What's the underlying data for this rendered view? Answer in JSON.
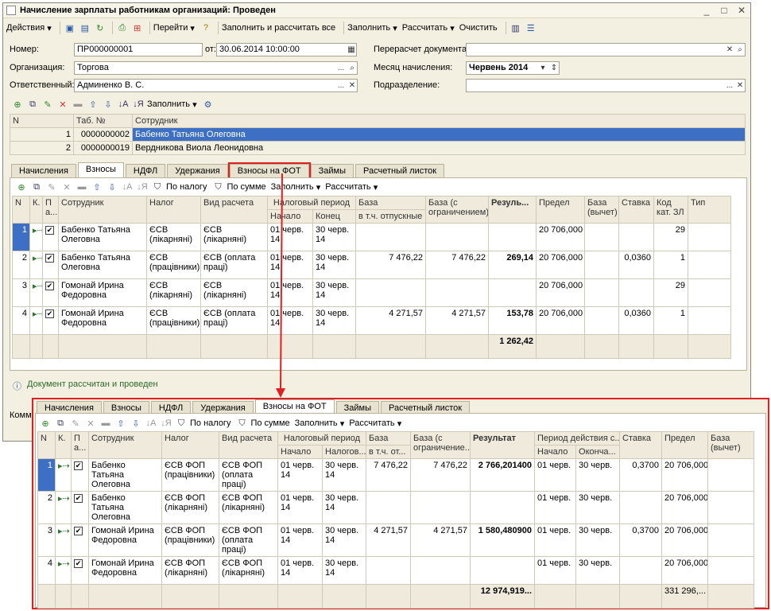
{
  "window": {
    "title": "Начисление зарплаты работникам организаций: Проведен"
  },
  "toolbar": {
    "actions": "Действия",
    "goto": "Перейти",
    "fill_calc_all": "Заполнить и рассчитать все",
    "fill": "Заполнить",
    "calc": "Рассчитать",
    "clear": "Очистить"
  },
  "form": {
    "number_label": "Номер:",
    "number_value": "ПР000000001",
    "from_label": "от:",
    "date_value": "30.06.2014 10:00:00",
    "recalc_label": "Перерасчет документа:",
    "org_label": "Организация:",
    "org_value": "Торгова",
    "month_label": "Месяц начисления:",
    "month_value": "Червень 2014",
    "resp_label": "Ответственный:",
    "resp_value": "Админенко В. С.",
    "dept_label": "Подразделение:"
  },
  "emp_toolbar": {
    "fill": "Заполнить"
  },
  "employees": {
    "headers": [
      "N",
      "Таб. №",
      "Сотрудник"
    ],
    "rows": [
      {
        "n": "1",
        "tab": "0000000002",
        "name": "Бабенко Татьяна Олеговна"
      },
      {
        "n": "2",
        "tab": "0000000019",
        "name": "Вердникова Виола Леонидовна"
      }
    ]
  },
  "tabs": [
    "Начисления",
    "Взносы",
    "НДФЛ",
    "Удержания",
    "Взносы на ФОТ",
    "Займы",
    "Расчетный листок"
  ],
  "grid_toolbar": {
    "by_tax": "По налогу",
    "by_sum": "По сумме",
    "fill": "Заполнить",
    "calc": "Рассчитать"
  },
  "grid1": {
    "headers": {
      "n": "N",
      "k": "К.",
      "p": "П а...",
      "emp": "Сотрудник",
      "tax": "Налог",
      "kind": "Вид расчета",
      "period": "Налоговый период",
      "start": "Начало",
      "end": "Конец",
      "base": "База",
      "base_vac": "в т.ч. отпускные",
      "base_lim": "База (с ограничением)",
      "result": "Резуль...",
      "limit": "Предел",
      "base_ded": "База (вычет)",
      "rate": "Ставка",
      "code": "Код кат. ЗЛ",
      "type": "Тип"
    },
    "rows": [
      {
        "n": "1",
        "emp": "Бабенко Татьяна Олеговна",
        "tax": "ЄСВ (лікарняні)",
        "kind": "ЄСВ (лікарняні)",
        "start": "01 черв. 14",
        "end": "30 черв. 14",
        "base": "",
        "base_lim": "",
        "result": "",
        "limit": "20 706,000",
        "rate": "",
        "code": "29"
      },
      {
        "n": "2",
        "emp": "Бабенко Татьяна Олеговна",
        "tax": "ЄСВ (працівники)",
        "kind": "ЄСВ (оплата праці)",
        "start": "01 черв. 14",
        "end": "30 черв. 14",
        "base": "7 476,22",
        "base_lim": "7 476,22",
        "result": "269,14",
        "limit": "20 706,000",
        "rate": "0,0360",
        "code": "1"
      },
      {
        "n": "3",
        "emp": "Гомонай Ирина Федоровна",
        "tax": "ЄСВ (лікарняні)",
        "kind": "ЄСВ (лікарняні)",
        "start": "01 черв. 14",
        "end": "30 черв. 14",
        "base": "",
        "base_lim": "",
        "result": "",
        "limit": "20 706,000",
        "rate": "",
        "code": "29"
      },
      {
        "n": "4",
        "emp": "Гомонай Ирина Федоровна",
        "tax": "ЄСВ (працівники)",
        "kind": "ЄСВ (оплата праці)",
        "start": "01 черв. 14",
        "end": "30 черв. 14",
        "base": "4 271,57",
        "base_lim": "4 271,57",
        "result": "153,78",
        "limit": "20 706,000",
        "rate": "0,0360",
        "code": "1"
      }
    ],
    "total": "1 262,42"
  },
  "status": {
    "text": "Документ рассчитан и проведен",
    "comment_label": "Комм"
  },
  "grid2": {
    "headers": {
      "n": "N",
      "k": "К.",
      "p": "П а...",
      "emp": "Сотрудник",
      "tax": "Налог",
      "kind": "Вид расчета",
      "period": "Налоговый период",
      "start": "Начало",
      "end": "Налогов...",
      "base": "База",
      "base_vac": "в т.ч. от...",
      "base_lim": "База (с ограничение...",
      "result": "Результат",
      "valid": "Период действия с...",
      "vstart": "Начало",
      "vend": "Оконча...",
      "rate": "Ставка",
      "limit": "Предел",
      "base_ded": "База (вычет)"
    },
    "rows": [
      {
        "n": "1",
        "emp": "Бабенко Татьяна Олеговна",
        "tax": "ЄСВ ФОП (працівники)",
        "kind": "ЄСВ ФОП (оплата праці)",
        "start": "01 черв. 14",
        "end": "30 черв. 14",
        "base": "7 476,22",
        "base_lim": "7 476,22",
        "result": "2 766,201400",
        "vstart": "01 черв.",
        "vend": "30 черв.",
        "rate": "0,3700",
        "limit": "20 706,000"
      },
      {
        "n": "2",
        "emp": "Бабенко Татьяна Олеговна",
        "tax": "ЄСВ ФОП (лікарняні)",
        "kind": "ЄСВ ФОП (лікарняні)",
        "start": "01 черв. 14",
        "end": "30 черв. 14",
        "base": "",
        "base_lim": "",
        "result": "",
        "vstart": "01 черв.",
        "vend": "30 черв.",
        "rate": "",
        "limit": "20 706,000"
      },
      {
        "n": "3",
        "emp": "Гомонай Ирина Федоровна",
        "tax": "ЄСВ ФОП (працівники)",
        "kind": "ЄСВ ФОП (оплата праці)",
        "start": "01 черв. 14",
        "end": "30 черв. 14",
        "base": "4 271,57",
        "base_lim": "4 271,57",
        "result": "1 580,480900",
        "vstart": "01 черв.",
        "vend": "30 черв.",
        "rate": "0,3700",
        "limit": "20 706,000"
      },
      {
        "n": "4",
        "emp": "Гомонай Ирина Федоровна",
        "tax": "ЄСВ ФОП (лікарняні)",
        "kind": "ЄСВ ФОП (лікарняні)",
        "start": "01 черв. 14",
        "end": "30 черв. 14",
        "base": "",
        "base_lim": "",
        "result": "",
        "vstart": "01 черв.",
        "vend": "30 черв.",
        "rate": "",
        "limit": "20 706,000"
      }
    ],
    "total_result": "12 974,919...",
    "total_limit": "331 296,..."
  },
  "colors": {
    "highlight": "#e02020",
    "selection": "#3d6fc4"
  }
}
